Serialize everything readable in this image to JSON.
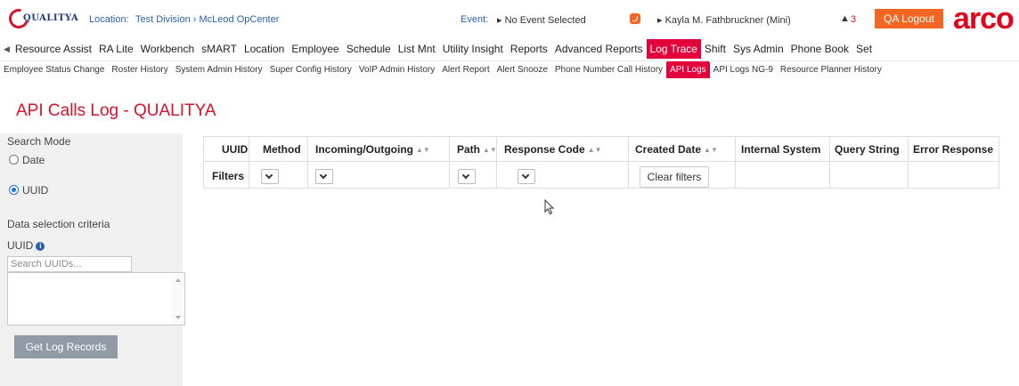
{
  "header": {
    "logo_text": "QUALITYA",
    "location_label": "Location:",
    "location_path": "Test Division › McLeod OpCenter",
    "event_label": "Event:",
    "event_value": "▸ No Event Selected",
    "user": "▸ Kayla M. Fathbruckner (Mini)",
    "bell_icon": "bell-icon",
    "alert_count": "3",
    "logout_label": "QA Logout",
    "brand": "arco",
    "colors": {
      "accent": "#e4003a",
      "logout": "#f26522",
      "link": "#2b5fad"
    }
  },
  "main_menu": {
    "items": [
      "Resource Assist",
      "RA Lite",
      "Workbench",
      "sMART",
      "Location",
      "Employee",
      "Schedule",
      "List Mnt",
      "Utility Insight",
      "Reports",
      "Advanced Reports",
      "Log Trace",
      "Shift",
      "Sys Admin",
      "Phone Book",
      "Set"
    ],
    "active": "Log Trace"
  },
  "sub_menu": {
    "items": [
      "Employee Status Change",
      "Roster History",
      "System Admin History",
      "Super Config History",
      "VoIP Admin History",
      "Alert Report",
      "Alert Snooze",
      "Phone Number Call History",
      "API Logs",
      "API Logs NG-9",
      "Resource Planner History"
    ],
    "active": "API Logs"
  },
  "page": {
    "title": "API Calls Log - QUALITYA"
  },
  "left_panel": {
    "search_mode_label": "Search Mode",
    "radio_date": "Date",
    "radio_uuid": "UUID",
    "selected_mode": "UUID",
    "criteria_label": "Data selection criteria",
    "uuid_label": "UUID",
    "search_placeholder": "Search UUIDs...",
    "get_button": "Get Log Records"
  },
  "table": {
    "columns": [
      "UUID",
      "Method",
      "Incoming/Outgoing",
      "Path",
      "Response Code",
      "Created Date",
      "Internal System",
      "Query String",
      "Error Response"
    ],
    "sortable": [
      "Incoming/Outgoing",
      "Path",
      "Response Code",
      "Created Date"
    ],
    "filters_label": "Filters",
    "clear_filters": "Clear filters"
  }
}
